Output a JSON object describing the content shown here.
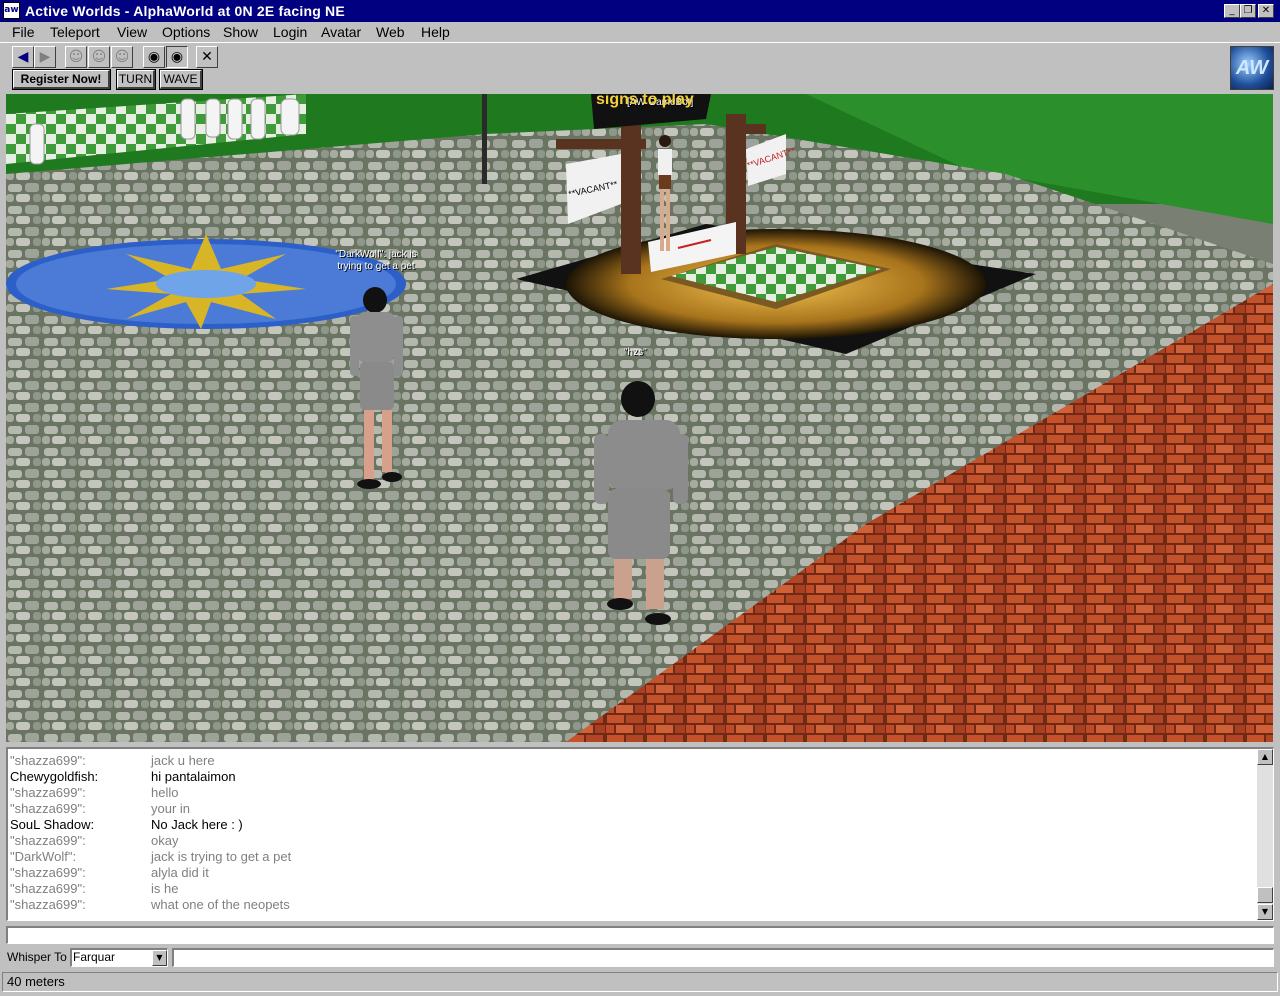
{
  "window": {
    "title": "Active Worlds - AlphaWorld  at 0N 2E facing NE",
    "app_icon": "aw"
  },
  "menu": [
    {
      "label": "File"
    },
    {
      "label": "Teleport"
    },
    {
      "label": "View"
    },
    {
      "label": "Options"
    },
    {
      "label": "Show"
    },
    {
      "label": "Login"
    },
    {
      "label": "Avatar"
    },
    {
      "label": "Web"
    },
    {
      "label": "Help"
    }
  ],
  "toolbar": {
    "icons": [
      "back-arrow-icon",
      "forward-arrow-icon",
      "gesture-1-icon",
      "gesture-2-icon",
      "gesture-3-icon",
      "camera-1-icon",
      "camera-2-icon",
      "tools-icon"
    ],
    "register_label": "Register Now!",
    "turn_label": "TURN",
    "wave_label": "WAVE",
    "logo": "AW"
  },
  "scene": {
    "labels": {
      "gamebot": "[AW GameBot]",
      "sign_top": "signs to play",
      "sign_left": "**VACANT**",
      "sign_right": "**VACANT**",
      "darkwolf_bubble": "\"DarkWolf\": jack is trying to get a pet",
      "player": "\"hzs\""
    }
  },
  "chat": [
    {
      "who": "\"shazza699\":",
      "msg": "jack u here",
      "gray": true
    },
    {
      "who": "Chewygoldfish:",
      "msg": "hi pantalaimon",
      "gray": false
    },
    {
      "who": "\"shazza699\":",
      "msg": "hello",
      "gray": true
    },
    {
      "who": "\"shazza699\":",
      "msg": "your in",
      "gray": true
    },
    {
      "who": "SouL Shadow:",
      "msg": "No Jack here : )",
      "gray": false
    },
    {
      "who": "\"shazza699\":",
      "msg": "okay",
      "gray": true
    },
    {
      "who": "\"DarkWolf\":",
      "msg": "jack is trying to get a pet",
      "gray": true
    },
    {
      "who": "\"shazza699\":",
      "msg": "alyla did it",
      "gray": true
    },
    {
      "who": "\"shazza699\":",
      "msg": "is he",
      "gray": true
    },
    {
      "who": "\"shazza699\":",
      "msg": "what one of the neopets",
      "gray": true
    }
  ],
  "whisper": {
    "label": "Whisper To",
    "selected": "Farquar"
  },
  "status": {
    "text": "40 meters"
  }
}
